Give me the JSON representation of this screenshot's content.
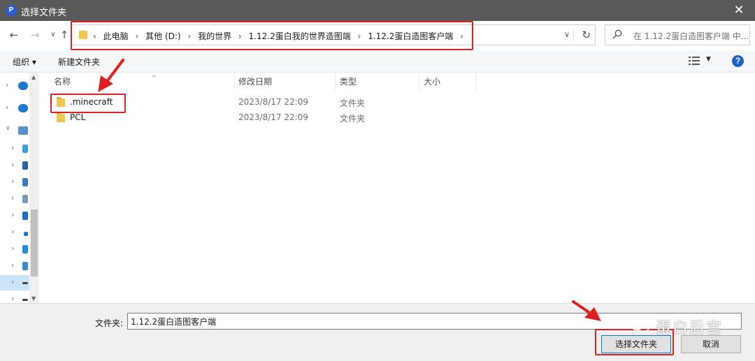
{
  "window": {
    "title": "选择文件夹",
    "app_icon_letter": "P",
    "close_glyph": "✕"
  },
  "nav_buttons": {
    "back": "←",
    "forward": "→",
    "recent": "∨",
    "up": "↑"
  },
  "address": {
    "breadcrumbs": [
      "此电脑",
      "其他 (D:)",
      "我的世界",
      "1.12.2蛋白我的世界造图端",
      "1.12.2蛋白造图客户端"
    ],
    "separator": "›",
    "dropdown_glyph": "∨",
    "refresh_glyph": "↻"
  },
  "search": {
    "placeholder": "在 1.12.2蛋白造图客户端 中..."
  },
  "toolbar": {
    "organize": "组织 ▾",
    "new_folder": "新建文件夹",
    "view_caret": "▼",
    "help": "?"
  },
  "columns": {
    "name": "名称",
    "modified": "修改日期",
    "type": "类型",
    "size": "大小",
    "sort_glyph": "^"
  },
  "files": [
    {
      "name": ".minecraft",
      "modified": "2023/8/17 22:09",
      "type": "文件夹"
    },
    {
      "name": "PCL",
      "modified": "2023/8/17 22:09",
      "type": "文件夹"
    }
  ],
  "navpane": {
    "arrow": "›",
    "expanded_arrow": "∨",
    "scroll_up": "▲",
    "scroll_down": "▼",
    "icon_colors": [
      "#1e78d2",
      "#1e78d2",
      "#5a8fd0",
      "#3aa0e0",
      "#2b5fb0",
      "#3a7cc8",
      "#7a9ab8",
      "#1e6fc8",
      "#1e78d2",
      "#1e90e0",
      "#3a8ad0",
      "#444444",
      "#444444"
    ]
  },
  "bottom": {
    "folder_label": "文件夹:",
    "folder_value": "1.12.2蛋白造图客户端",
    "select_button": "选择文件夹",
    "cancel_button": "取消"
  },
  "watermark": {
    "text": "蛋白后宫"
  },
  "colors": {
    "highlight_red": "#e02020",
    "titlebar": "#595959",
    "folder_yellow": "#f3c64e",
    "accent_blue": "#0078d7"
  }
}
